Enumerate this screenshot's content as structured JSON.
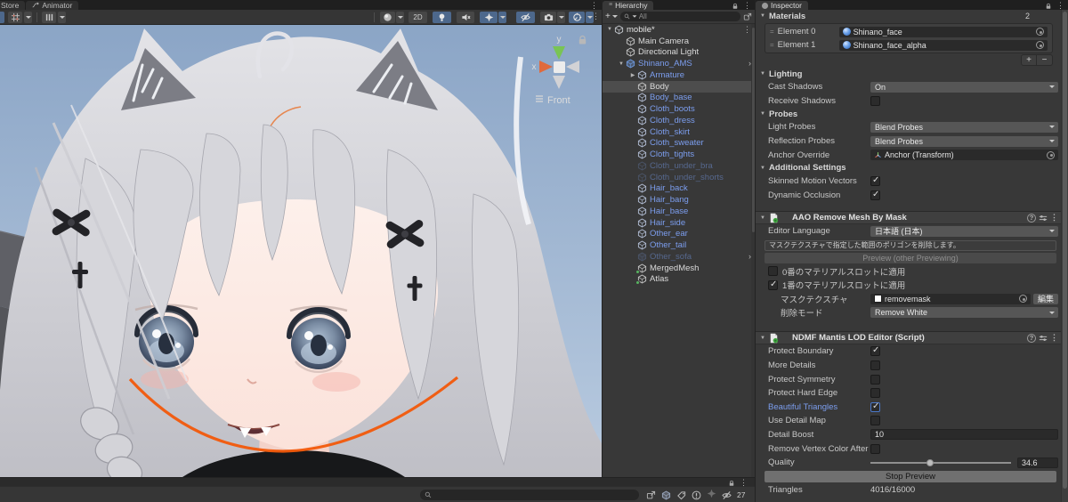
{
  "colors": {
    "accent_blue": "#7c9eef",
    "selection_orange": "#f2590a",
    "toggle_active": "#4d688c",
    "added_badge_green": "#57b560"
  },
  "scene_panel": {
    "tabs": [
      {
        "label": "Store"
      },
      {
        "label": "Animator"
      }
    ],
    "toolbar": {
      "mode_2d_label": "2D"
    },
    "viewport": {
      "gizmo_x_label": "x",
      "gizmo_y_label": "y",
      "view_label": "Front"
    }
  },
  "hierarchy_panel": {
    "tab_label": "Hierarchy",
    "create_label": "+",
    "search_placeholder": "All",
    "items": [
      {
        "label": "mobile*",
        "depth": 0,
        "kind": "scene",
        "arrow": "down",
        "trailing": "kebab"
      },
      {
        "label": "Main Camera",
        "depth": 1,
        "kind": "go"
      },
      {
        "label": "Directional Light",
        "depth": 1,
        "kind": "go"
      },
      {
        "label": "Shinano_AMS",
        "depth": 1,
        "kind": "prefab",
        "arrow": "down",
        "trailing": "chevron"
      },
      {
        "label": "Armature",
        "depth": 2,
        "kind": "prefab-child",
        "arrow": "right"
      },
      {
        "label": "Body",
        "depth": 2,
        "kind": "go",
        "selected": true
      },
      {
        "label": "Body_base",
        "depth": 2,
        "kind": "prefab-child"
      },
      {
        "label": "Cloth_boots",
        "depth": 2,
        "kind": "prefab-child"
      },
      {
        "label": "Cloth_dress",
        "depth": 2,
        "kind": "prefab-child"
      },
      {
        "label": "Cloth_skirt",
        "depth": 2,
        "kind": "prefab-child"
      },
      {
        "label": "Cloth_sweater",
        "depth": 2,
        "kind": "prefab-child"
      },
      {
        "label": "Cloth_tights",
        "depth": 2,
        "kind": "prefab-child"
      },
      {
        "label": "Cloth_under_bra",
        "depth": 2,
        "kind": "prefab-child-disabled"
      },
      {
        "label": "Cloth_under_shorts",
        "depth": 2,
        "kind": "prefab-child-disabled"
      },
      {
        "label": "Hair_back",
        "depth": 2,
        "kind": "prefab-child"
      },
      {
        "label": "Hair_bang",
        "depth": 2,
        "kind": "prefab-child"
      },
      {
        "label": "Hair_base",
        "depth": 2,
        "kind": "prefab-child"
      },
      {
        "label": "Hair_side",
        "depth": 2,
        "kind": "prefab-child"
      },
      {
        "label": "Other_ear",
        "depth": 2,
        "kind": "prefab-child"
      },
      {
        "label": "Other_tail",
        "depth": 2,
        "kind": "prefab-child"
      },
      {
        "label": "Other_sofa",
        "depth": 2,
        "kind": "prefab-disabled",
        "trailing": "chevron"
      },
      {
        "label": "MergedMesh",
        "depth": 2,
        "kind": "go-added"
      },
      {
        "label": "Atlas",
        "depth": 2,
        "kind": "go-added"
      }
    ]
  },
  "inspector_panel": {
    "tab_label": "Inspector",
    "materials": {
      "title": "Materials",
      "count": "2",
      "elements": [
        {
          "label": "Element 0",
          "value": "Shinano_face"
        },
        {
          "label": "Element 1",
          "value": "Shinano_face_alpha"
        }
      ],
      "add_label": "+",
      "remove_label": "−"
    },
    "lighting": {
      "title": "Lighting",
      "cast_shadows_label": "Cast Shadows",
      "cast_shadows_value": "On",
      "receive_shadows_label": "Receive Shadows",
      "receive_shadows_checked": false
    },
    "probes": {
      "title": "Probes",
      "light_probes_label": "Light Probes",
      "light_probes_value": "Blend Probes",
      "reflection_probes_label": "Reflection Probes",
      "reflection_probes_value": "Blend Probes",
      "anchor_override_label": "Anchor Override",
      "anchor_override_value": "Anchor (Transform)"
    },
    "additional_settings": {
      "title": "Additional Settings",
      "skinned_motion_vectors_label": "Skinned Motion Vectors",
      "skinned_motion_vectors_checked": true,
      "dynamic_occlusion_label": "Dynamic Occlusion",
      "dynamic_occlusion_checked": true
    },
    "aao_component": {
      "title": "AAO Remove Mesh By Mask",
      "editor_language_label": "Editor Language",
      "editor_language_value": "日本語 (日本)",
      "help_text": "マスクテクスチャで指定した範囲のポリゴンを削除します。",
      "preview_button": "Preview (other Previewing)",
      "slot0_label": "0番のマテリアルスロットに適用",
      "slot0_checked": false,
      "slot1_label": "1番のマテリアルスロットに適用",
      "slot1_checked": true,
      "mask_texture_label": "マスクテクスチャ",
      "mask_texture_value": "removemask",
      "edit_button": "編集",
      "delete_mode_label": "削除モード",
      "delete_mode_value": "Remove White"
    },
    "ndmf_component": {
      "title": "NDMF Mantis LOD Editor (Script)",
      "rows": [
        {
          "label": "Protect Boundary",
          "checked": true
        },
        {
          "label": "More Details",
          "checked": false
        },
        {
          "label": "Protect Symmetry",
          "checked": false
        },
        {
          "label": "Protect Hard Edge",
          "checked": false
        },
        {
          "label": "Beautiful Triangles",
          "checked": true,
          "override": true
        },
        {
          "label": "Use Detail Map",
          "checked": false
        }
      ],
      "detail_boost_label": "Detail Boost",
      "detail_boost_value": "10",
      "remove_vertex_label": "Remove Vertex Color After (",
      "remove_vertex_checked": false,
      "quality_label": "Quality",
      "quality_value": "34.6",
      "stop_preview_button": "Stop Preview",
      "triangles_label": "Triangles",
      "triangles_value": "4016/16000"
    }
  },
  "bottom_panel": {
    "search_placeholder": "",
    "hidden_count": "27"
  }
}
